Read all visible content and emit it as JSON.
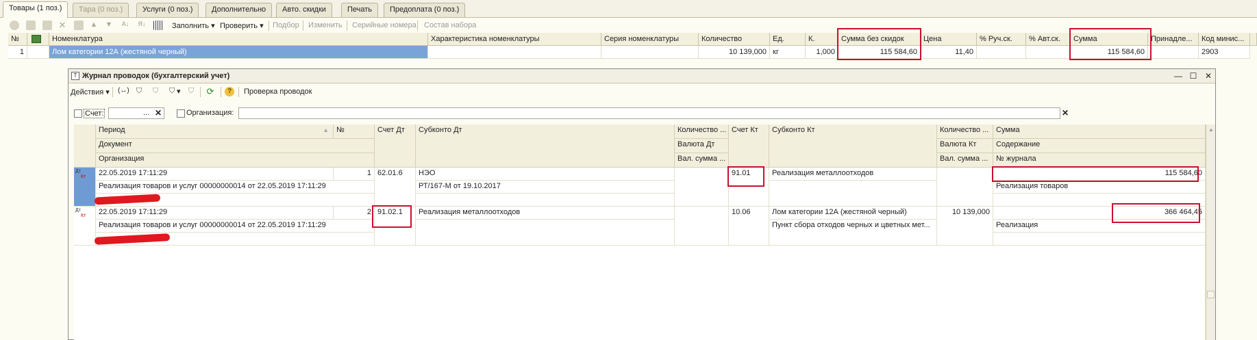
{
  "tabs": [
    {
      "label": "Товары (1 поз.)",
      "active": true,
      "disabled": false
    },
    {
      "label": "Тара (0 поз.)",
      "active": false,
      "disabled": true
    },
    {
      "label": "Услуги (0 поз.)",
      "active": false,
      "disabled": false
    },
    {
      "label": "Дополнительно",
      "active": false,
      "disabled": false
    },
    {
      "label": "Авто. скидки",
      "active": false,
      "disabled": false
    },
    {
      "label": "Печать",
      "active": false,
      "disabled": false
    },
    {
      "label": "Предоплата (0 поз.)",
      "active": false,
      "disabled": false
    }
  ],
  "toolbar": {
    "fill": "Заполнить",
    "check": "Проверить",
    "pick": "Подбор",
    "change": "Изменить",
    "serials": "Серийные номера",
    "set_content": "Состав набора"
  },
  "goods_grid": {
    "headers": [
      "№",
      "Номенклатура",
      "Характеристика номенклатуры",
      "Серия номенклатуры",
      "Количество",
      "Ед.",
      "К.",
      "Сумма без скидок",
      "Цена",
      "% Руч.ск.",
      "% Авт.ск.",
      "Сумма",
      "Принадле...",
      "Код минис..."
    ],
    "row": {
      "num": "1",
      "item": "Лом категории 12А (жестяной черный)",
      "characteristic": "",
      "series": "",
      "qty": "10 139,000",
      "unit": "кг",
      "k": "1,000",
      "sum_no_discount": "115 584,60",
      "price": "11,40",
      "manual_disc": "",
      "auto_disc": "",
      "sum": "115 584,60",
      "owner": "",
      "code": "2903"
    }
  },
  "journal": {
    "title": "Журнал проводок (бухгалтерский учет)",
    "toolbar": {
      "actions": "Действия",
      "check_postings": "Проверка проводок"
    },
    "filter": {
      "account_label": "Счет:",
      "account_value": "...",
      "org_label": "Организация:",
      "org_value": ""
    },
    "headers": {
      "period": "Период",
      "document": "Документ",
      "organization": "Организация",
      "num": "№",
      "account_dt": "Счет Дт",
      "subconto_dt": "Субконто Дт",
      "qty_dt": "Количество ...",
      "currency_dt": "Валюта Дт",
      "val_sum_dt": "Вал. сумма ...",
      "account_kt": "Счет Кт",
      "subconto_kt": "Субконто Кт",
      "qty_kt": "Количество ...",
      "currency_kt": "Валюта Кт",
      "val_sum_kt": "Вал. сумма ...",
      "sum": "Сумма",
      "content": "Содержание",
      "journal_no": "№ журнала"
    },
    "rows": [
      {
        "icon_dt": "Дт",
        "icon_kt": "Кт",
        "period": "22.05.2019 17:11:29",
        "num": "1",
        "document": "Реализация товаров и услуг 00000000014 от 22.05.2019 17:11:29",
        "account_dt": "62.01.6",
        "subconto_dt_1": "НЭО",
        "subconto_dt_2": "РТ/167-М от 19.10.2017",
        "account_kt": "91.01",
        "subconto_kt_1": "Реализация металлоотходов",
        "subconto_kt_2": "",
        "qty_kt": "",
        "sum": "115 584,60",
        "content": "Реализация товаров"
      },
      {
        "icon_dt": "Дт",
        "icon_kt": "Кт",
        "period": "22.05.2019 17:11:29",
        "num": "2",
        "document": "Реализация товаров и услуг 00000000014 от 22.05.2019 17:11:29",
        "account_dt": "91.02.1",
        "subconto_dt_1": "Реализация металлоотходов",
        "subconto_dt_2": "",
        "account_kt": "10.06",
        "subconto_kt_1": "Лом категории 12А (жестяной черный)",
        "subconto_kt_2": "Пункт сбора отходов черных и цветных мет...",
        "qty_kt": "10 139,000",
        "sum": "366 464,45",
        "content": "Реализация"
      }
    ]
  },
  "colors": {
    "highlight": "#c8102e",
    "selection": "#7aa3d8",
    "header_bg": "#f2efdd"
  }
}
